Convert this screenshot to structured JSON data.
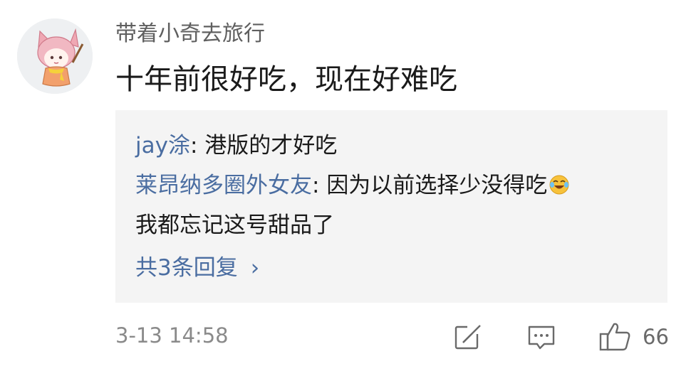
{
  "comment": {
    "username": "带着小奇去旅行",
    "text": "十年前很好吃，现在好难吃",
    "timestamp": "3-13 14:58",
    "like_count": "66"
  },
  "replies": [
    {
      "author": "jay涂",
      "separator": ": ",
      "text": "港版的才好吃"
    },
    {
      "author": "莱昂纳多圈外女友",
      "separator": ": ",
      "text": "因为以前选择少没得吃",
      "text_continued": "我都忘记这号甜品了",
      "emoji": "laughing-crying-emoji"
    }
  ],
  "more_replies": {
    "label": "共3条回复",
    "chevron": "›"
  },
  "colors": {
    "author_link": "#4a6da1",
    "reply_background": "#f4f4f4",
    "meta_text": "#8a8a8a"
  },
  "icons": [
    "avatar",
    "share-icon",
    "comment-icon",
    "thumbs-up-icon",
    "laughing-crying-emoji"
  ]
}
